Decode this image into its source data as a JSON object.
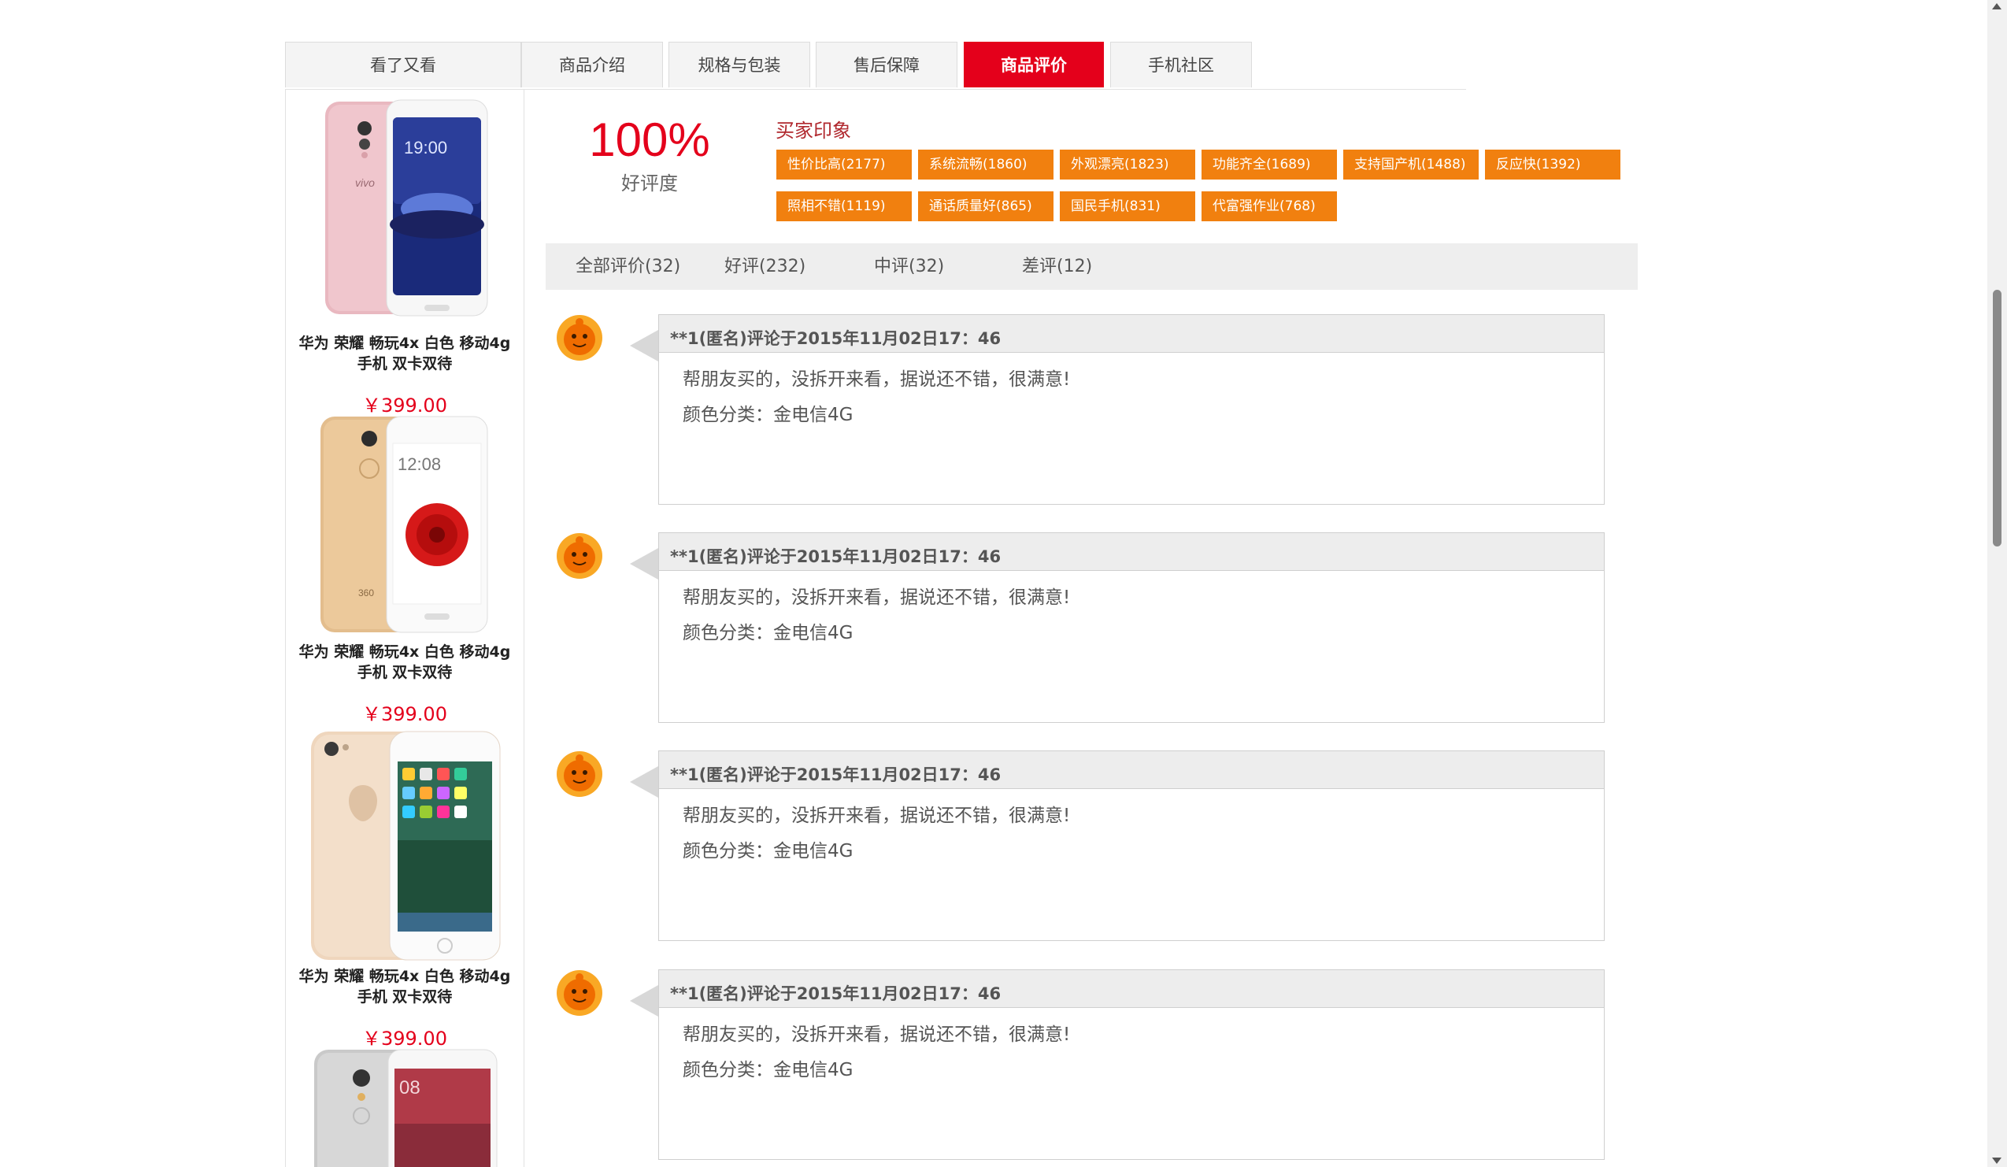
{
  "tabs": [
    {
      "label": "看了又看",
      "active": false
    },
    {
      "label": "商品介绍",
      "active": false
    },
    {
      "label": "规格与包装",
      "active": false
    },
    {
      "label": "售后保障",
      "active": false
    },
    {
      "label": "商品评价",
      "active": true
    },
    {
      "label": "手机社区",
      "active": false
    }
  ],
  "sidebar": {
    "products": [
      {
        "name": "华为 荣耀 畅玩4x 白色 移动4g手机 双卡双待",
        "price": "￥399.00",
        "icon": "phone-image-vivo-pink"
      },
      {
        "name": "华为 荣耀 畅玩4x 白色 移动4g手机 双卡双待",
        "price": "￥399.00",
        "icon": "phone-image-360-gold"
      },
      {
        "name": "华为 荣耀 畅玩4x 白色 移动4g手机 双卡双待",
        "price": "￥399.00",
        "icon": "phone-image-iphone-gold"
      },
      {
        "name": "",
        "price": "",
        "icon": "phone-image-xiaomi-silver"
      }
    ]
  },
  "rating": {
    "percent": "100%",
    "label": "好评度"
  },
  "impressions": {
    "title": "买家印象",
    "tags": [
      "性价比高(2177)",
      "系统流畅(1860)",
      "外观漂亮(1823)",
      "功能齐全(1689)",
      "支持国产机(1488)",
      "反应快(1392)",
      "照相不错(1119)",
      "通话质量好(865)",
      "国民手机(831)",
      "代富强作业(768)"
    ]
  },
  "filters": [
    "全部评价(32)",
    "好评(232)",
    "中评(32)",
    "差评(12)"
  ],
  "reviews": [
    {
      "header": "**1(匿名)评论于2015年11月02日17：46",
      "text": "帮朋友买的，没拆开来看，据说还不错，很满意!",
      "color": "颜色分类：金电信4G"
    },
    {
      "header": "**1(匿名)评论于2015年11月02日17：46",
      "text": "帮朋友买的，没拆开来看，据说还不错，很满意!",
      "color": "颜色分类：金电信4G"
    },
    {
      "header": "**1(匿名)评论于2015年11月02日17：46",
      "text": "帮朋友买的，没拆开来看，据说还不错，很满意!",
      "color": "颜色分类：金电信4G"
    },
    {
      "header": "**1(匿名)评论于2015年11月02日17：46",
      "text": "帮朋友买的，没拆开来看，据说还不错，很满意!",
      "color": "颜色分类：金电信4G"
    }
  ],
  "colors": {
    "accent_red": "#e4001b",
    "tag_orange": "#f1800f",
    "impression_title": "#b0282e"
  }
}
